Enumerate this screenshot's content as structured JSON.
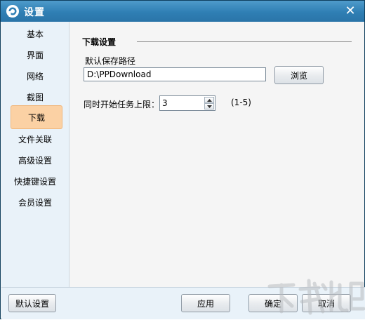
{
  "window": {
    "title": "设置",
    "close_symbol": "✕"
  },
  "sidebar": {
    "active_index": 4,
    "items": [
      {
        "label": "基本"
      },
      {
        "label": "界面"
      },
      {
        "label": "网络"
      },
      {
        "label": "截图"
      },
      {
        "label": "下载"
      },
      {
        "label": "文件关联"
      },
      {
        "label": "高级设置"
      },
      {
        "label": "快捷键设置"
      },
      {
        "label": "会员设置"
      }
    ]
  },
  "download": {
    "section_title": "下载设置",
    "path_label": "默认保存路径",
    "path_value": "D:\\PPDownload",
    "browse_label": "浏览",
    "tasks_label": "同时开始任务上限：",
    "tasks_value": "3",
    "tasks_range": "(1-5)"
  },
  "footer": {
    "default_label": "默认设置",
    "apply_label": "应用",
    "ok_label": "确定",
    "cancel_label": "取消"
  },
  "colors": {
    "title_bar": "#3a86bb",
    "sidebar_bg": "#e9f2f9",
    "active_item": "#fbd1a4"
  }
}
